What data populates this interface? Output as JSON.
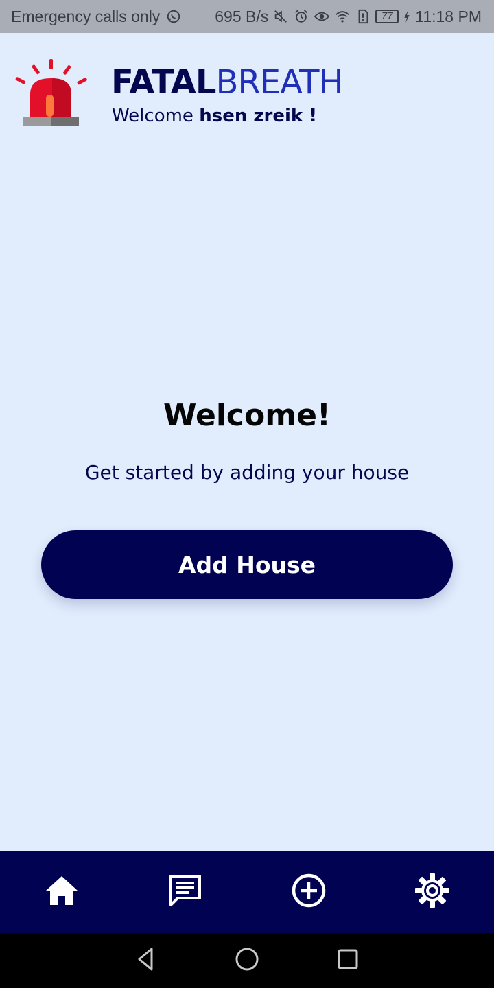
{
  "status_bar": {
    "carrier": "Emergency calls only",
    "net_speed": "695 B/s",
    "battery": "77",
    "time": "11:18 PM",
    "icons": [
      "whatsapp-icon",
      "mute-icon",
      "alarm-icon",
      "eye-icon",
      "wifi-icon",
      "sim-alert-icon",
      "battery-icon",
      "charging-icon"
    ]
  },
  "header": {
    "brand_strong": "FATAL",
    "brand_light": "BREATH",
    "welcome_prefix": "Welcome ",
    "username": "hsen zreik !",
    "logo_icon": "siren-icon"
  },
  "main": {
    "title": "Welcome!",
    "subtitle": "Get started by adding your house",
    "add_house_label": "Add House"
  },
  "bottom_nav": {
    "items": [
      {
        "icon": "home-icon"
      },
      {
        "icon": "message-icon"
      },
      {
        "icon": "add-circle-icon"
      },
      {
        "icon": "settings-icon"
      }
    ]
  },
  "system_nav": {
    "items": [
      {
        "icon": "back-icon"
      },
      {
        "icon": "home-circle-icon"
      },
      {
        "icon": "recents-icon"
      }
    ]
  },
  "colors": {
    "background": "#e1edfd",
    "primary": "#010352",
    "brand_light": "#1f2fb8",
    "status_bar": "#a9adb6",
    "siren_red": "#e3102a"
  }
}
